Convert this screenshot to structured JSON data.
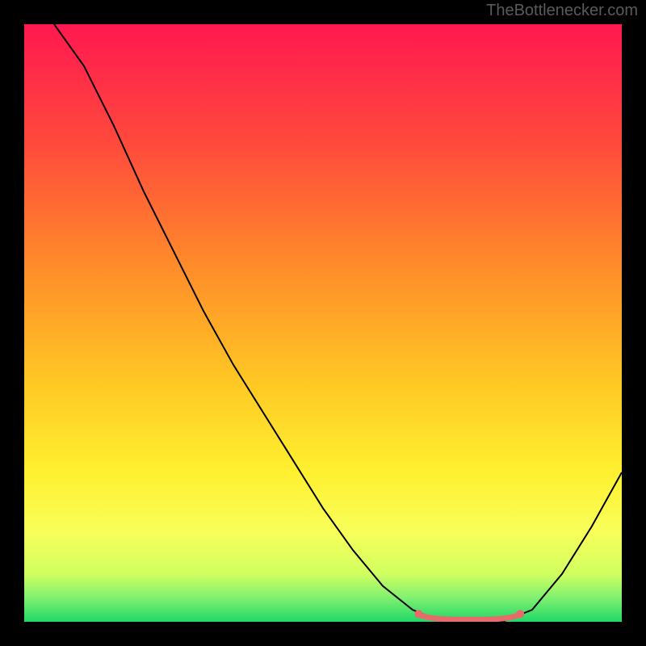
{
  "watermark": "TheBottlenecker.com",
  "chart_data": {
    "type": "line",
    "title": "",
    "xlabel": "",
    "ylabel": "",
    "xlim": [
      0,
      100
    ],
    "ylim": [
      0,
      100
    ],
    "series": [
      {
        "name": "bottleneck-curve",
        "points": [
          {
            "x": 5,
            "y": 100
          },
          {
            "x": 10,
            "y": 93
          },
          {
            "x": 15,
            "y": 83
          },
          {
            "x": 20,
            "y": 72
          },
          {
            "x": 25,
            "y": 62
          },
          {
            "x": 30,
            "y": 52
          },
          {
            "x": 35,
            "y": 43
          },
          {
            "x": 40,
            "y": 35
          },
          {
            "x": 45,
            "y": 27
          },
          {
            "x": 50,
            "y": 19
          },
          {
            "x": 55,
            "y": 12
          },
          {
            "x": 60,
            "y": 6
          },
          {
            "x": 65,
            "y": 2
          },
          {
            "x": 70,
            "y": 0
          },
          {
            "x": 75,
            "y": 0
          },
          {
            "x": 80,
            "y": 0
          },
          {
            "x": 85,
            "y": 2
          },
          {
            "x": 90,
            "y": 8
          },
          {
            "x": 95,
            "y": 16
          },
          {
            "x": 100,
            "y": 25
          }
        ]
      },
      {
        "name": "optimal-range",
        "xstart": 66,
        "xend": 83,
        "y": 0.5
      }
    ],
    "gradient": {
      "stops": [
        {
          "offset": 0,
          "color": "#ff1850"
        },
        {
          "offset": 20,
          "color": "#ff4a3c"
        },
        {
          "offset": 40,
          "color": "#ff8a2a"
        },
        {
          "offset": 60,
          "color": "#ffc824"
        },
        {
          "offset": 75,
          "color": "#fff030"
        },
        {
          "offset": 85,
          "color": "#f8ff5a"
        },
        {
          "offset": 92,
          "color": "#d0ff60"
        },
        {
          "offset": 96,
          "color": "#80f070"
        },
        {
          "offset": 100,
          "color": "#20d868"
        }
      ]
    }
  }
}
